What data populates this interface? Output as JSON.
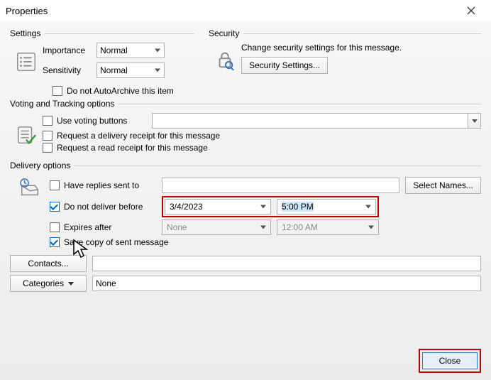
{
  "title": "Properties",
  "settings": {
    "legend": "Settings",
    "importance_label": "Importance",
    "importance_value": "Normal",
    "sensitivity_label": "Sensitivity",
    "sensitivity_value": "Normal",
    "autoarchive_label": "Do not AutoArchive this item",
    "autoarchive_checked": false
  },
  "security": {
    "legend": "Security",
    "desc": "Change security settings for this message.",
    "button": "Security Settings..."
  },
  "voting": {
    "legend": "Voting and Tracking options",
    "use_voting_label": "Use voting buttons",
    "use_voting_checked": false,
    "voting_value": "",
    "delivery_receipt_label": "Request a delivery receipt for this message",
    "delivery_receipt_checked": false,
    "read_receipt_label": "Request a read receipt for this message",
    "read_receipt_checked": false
  },
  "delivery": {
    "legend": "Delivery options",
    "replies_label": "Have replies sent to",
    "replies_checked": false,
    "replies_value": "",
    "select_names": "Select Names...",
    "deliver_label": "Do not deliver before",
    "deliver_checked": true,
    "deliver_date": "3/4/2023",
    "deliver_time": "5:00 PM",
    "expires_label": "Expires after",
    "expires_checked": false,
    "expires_date": "None",
    "expires_time": "12:00 AM",
    "savecopy_label": "Save copy of sent message",
    "savecopy_checked": true
  },
  "bottom": {
    "contacts_btn": "Contacts...",
    "contacts_value": "",
    "categories_btn": "Categories",
    "categories_value": "None"
  },
  "footer": {
    "close_btn": "Close"
  }
}
